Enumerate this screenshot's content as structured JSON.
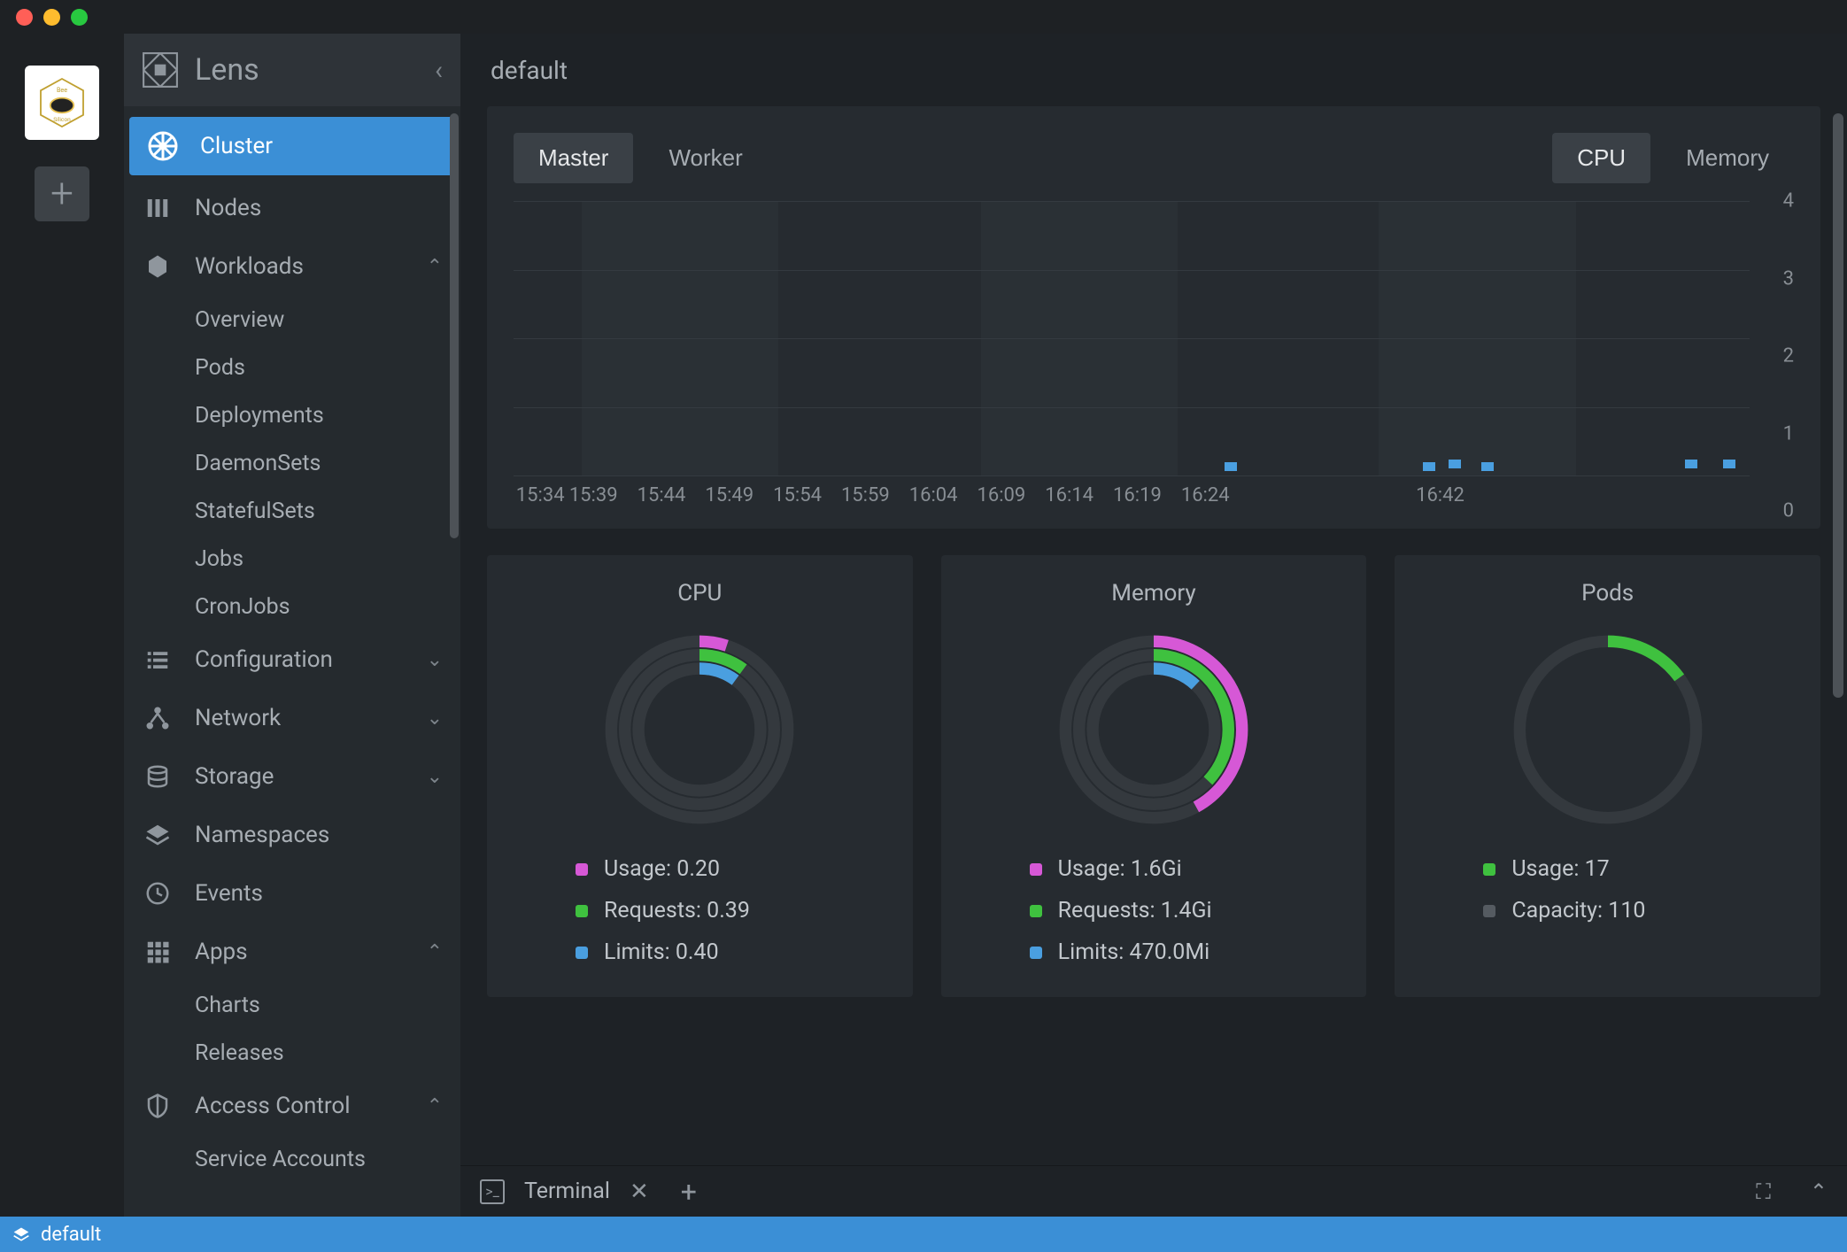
{
  "app": {
    "title": "Lens"
  },
  "breadcrumb": "default",
  "sidebar": {
    "items": [
      {
        "label": "Cluster"
      },
      {
        "label": "Nodes"
      },
      {
        "label": "Workloads"
      },
      {
        "label": "Configuration"
      },
      {
        "label": "Network"
      },
      {
        "label": "Storage"
      },
      {
        "label": "Namespaces"
      },
      {
        "label": "Events"
      },
      {
        "label": "Apps"
      },
      {
        "label": "Access Control"
      }
    ],
    "workloads_children": [
      {
        "label": "Overview"
      },
      {
        "label": "Pods"
      },
      {
        "label": "Deployments"
      },
      {
        "label": "DaemonSets"
      },
      {
        "label": "StatefulSets"
      },
      {
        "label": "Jobs"
      },
      {
        "label": "CronJobs"
      }
    ],
    "apps_children": [
      {
        "label": "Charts"
      },
      {
        "label": "Releases"
      }
    ],
    "access_children": [
      {
        "label": "Service Accounts"
      }
    ]
  },
  "tabs_left": {
    "master": "Master",
    "worker": "Worker"
  },
  "tabs_right": {
    "cpu": "CPU",
    "memory": "Memory"
  },
  "chart_data": {
    "type": "bar",
    "categories": [
      "15:34",
      "15:39",
      "15:44",
      "15:49",
      "15:54",
      "15:59",
      "16:04",
      "16:09",
      "16:14",
      "16:19",
      "16:24",
      "16:42"
    ],
    "values": [
      0,
      0,
      0,
      0,
      0,
      0,
      0,
      0,
      0,
      0,
      0.1,
      0.1
    ],
    "title": "",
    "xlabel": "",
    "ylabel": "",
    "ylim": [
      0,
      4
    ],
    "y_ticks": [
      0,
      1,
      2,
      3,
      4
    ]
  },
  "gauges": {
    "cpu": {
      "title": "CPU",
      "usage_label": "Usage: 0.20",
      "requests_label": "Requests: 0.39",
      "limits_label": "Limits: 0.40",
      "usage_pct": 5,
      "requests_pct": 10,
      "limits_pct": 10
    },
    "memory": {
      "title": "Memory",
      "usage_label": "Usage: 1.6Gi",
      "requests_label": "Requests: 1.4Gi",
      "limits_label": "Limits: 470.0Mi",
      "usage_pct": 42,
      "requests_pct": 37,
      "limits_pct": 12
    },
    "pods": {
      "title": "Pods",
      "usage_label": "Usage: 17",
      "capacity_label": "Capacity: 110",
      "usage_pct": 15
    }
  },
  "terminal": {
    "label": "Terminal"
  },
  "status": {
    "text": "default"
  },
  "colors": {
    "usage": "#d658d6",
    "requests": "#3fc13f",
    "limits": "#4a9fe0",
    "capacity": "#555b61",
    "ring_bg": "#34393e"
  }
}
